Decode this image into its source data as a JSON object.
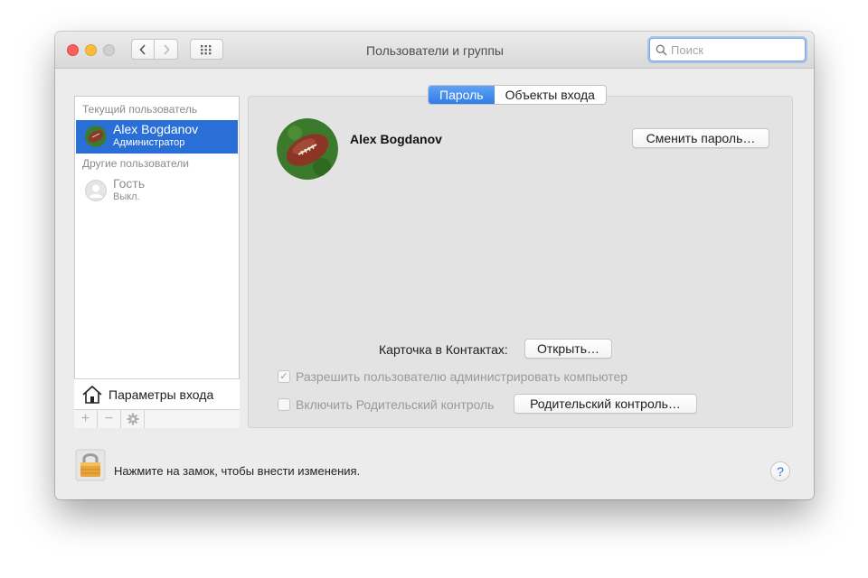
{
  "window": {
    "title": "Пользователи и группы",
    "search_placeholder": "Поиск"
  },
  "sidebar": {
    "current_section": "Текущий пользователь",
    "current_user": {
      "name": "Alex Bogdanov",
      "role": "Администратор"
    },
    "other_section": "Другие пользователи",
    "guest_user": {
      "name": "Гость",
      "status": "Выкл."
    },
    "login_options_label": "Параметры входа",
    "tools": {
      "add": "+",
      "remove": "−"
    }
  },
  "main": {
    "tabs": [
      {
        "label": "Пароль",
        "active": true
      },
      {
        "label": "Объекты входа",
        "active": false
      }
    ],
    "user_name": "Alex Bogdanov",
    "change_password_label": "Сменить пароль…",
    "contacts_card_label": "Карточка в Контактах:",
    "open_label": "Открыть…",
    "allow_admin": {
      "label": "Разрешить пользователю администрировать компьютер",
      "checked": true
    },
    "parental_controls": {
      "label": "Включить Родительский контроль",
      "checked": false
    },
    "parental_controls_button": "Родительский контроль…"
  },
  "footer": {
    "lock_text": "Нажмите на замок, чтобы внести изменения.",
    "help_label": "?"
  },
  "colors": {
    "selection": "#2a6fd8",
    "tab_active": "#3a85ec",
    "close": "#fc605c",
    "minimize": "#fdbc40"
  }
}
